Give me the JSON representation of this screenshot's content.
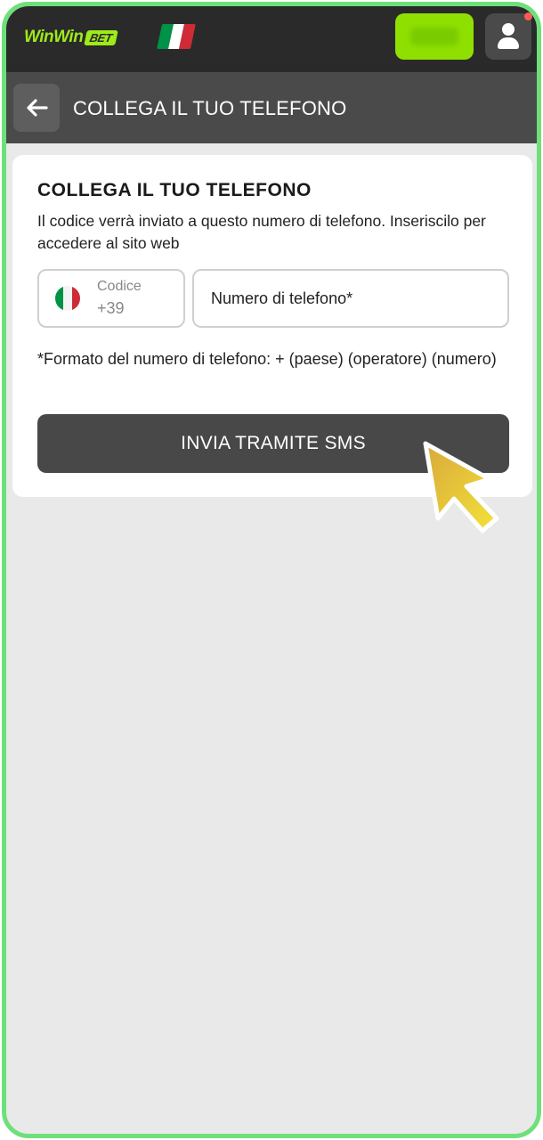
{
  "header": {
    "logo_text": "WinWin",
    "logo_badge": "BET",
    "flag_colors": [
      "#009246",
      "#ffffff",
      "#ce2b37"
    ],
    "accent_color": "#8fe000",
    "icons": [
      "flag-italy-icon",
      "user-icon",
      "notification-dot-icon"
    ]
  },
  "subheader": {
    "title": "COLLEGA IL TUO TELEFONO",
    "back_icon": "arrow-left-icon"
  },
  "card": {
    "title": "COLLEGA IL TUO TELEFONO",
    "description": "Il codice verrà inviato a questo numero di telefono. Inseriscilo per accedere al sito web",
    "code_label": "Codice",
    "code_value": "+39",
    "phone_placeholder": "Numero di telefono*",
    "phone_value": "",
    "hint": "*Formato del numero di telefono: + (paese) (operatore) (numero)",
    "sms_button_label": "INVIA TRAMITE SMS"
  },
  "overlay": {
    "cursor_icon": "pointer-cursor-icon"
  }
}
